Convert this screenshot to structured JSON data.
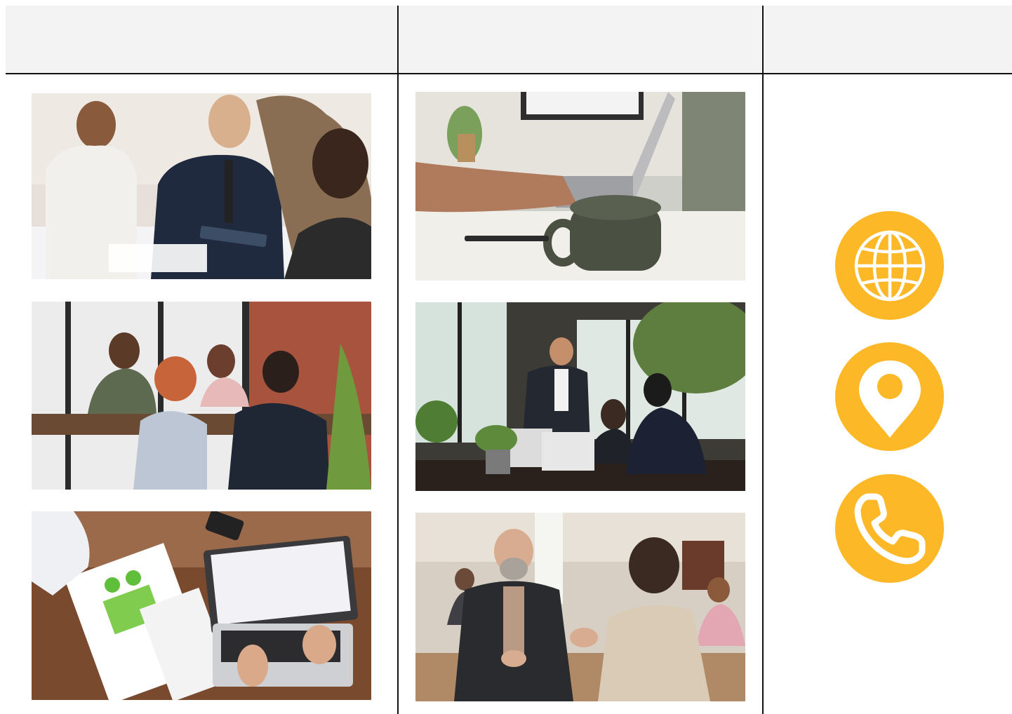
{
  "header": {
    "columns": [
      "",
      "",
      ""
    ]
  },
  "colors": {
    "accent": "#FDB827",
    "rule": "#111111",
    "header_background": "#F3F3F3",
    "icon_glyph": "#FFFFFF"
  },
  "gallery": {
    "left_column": [
      {
        "image": "team-meeting-with-tablet-photo"
      },
      {
        "image": "group-discussion-at-table-photo"
      },
      {
        "image": "laptop-and-report-overhead-photo"
      }
    ],
    "middle_column": [
      {
        "image": "typing-on-laptop-with-coffee-photo"
      },
      {
        "image": "office-team-at-laptops-photo"
      },
      {
        "image": "two-men-talking-in-cafe-photo"
      }
    ]
  },
  "contact_icons": [
    {
      "icon": "globe-icon"
    },
    {
      "icon": "location-pin-icon"
    },
    {
      "icon": "phone-icon"
    }
  ]
}
